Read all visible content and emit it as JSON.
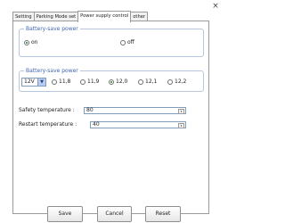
{
  "tabs": [
    "Setting",
    "Parking Mode set",
    "Power supply control",
    "other"
  ],
  "active_tab": "Power supply control",
  "battery_save_power": {
    "legend": "Battery-save power",
    "options": [
      "on",
      "off"
    ],
    "selected": "on"
  },
  "battery_save_voltage": {
    "legend": "Battery-save power",
    "system_voltage": "12V",
    "options": [
      "11,8",
      "11,9",
      "12,0",
      "12,1",
      "12,2"
    ],
    "selected": "12,0"
  },
  "safety_temperature": {
    "label": "Safety temperature :",
    "value": "80"
  },
  "restart_temperature": {
    "label": "Restart temperature :",
    "value": "40"
  },
  "buttons": {
    "save": "Save",
    "cancel": "Cancel",
    "reset": "Reset"
  },
  "icons": {
    "close": "close-icon",
    "dropdown": "chevron-down-icon"
  }
}
